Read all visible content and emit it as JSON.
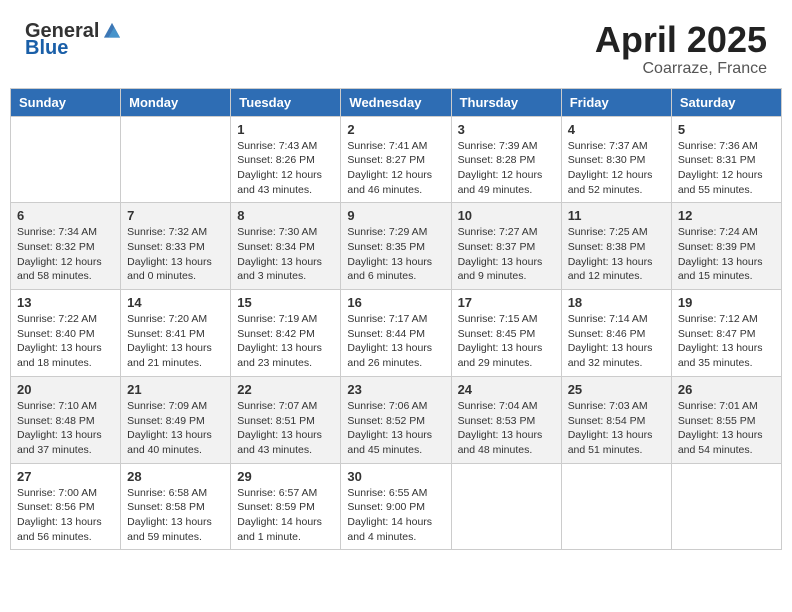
{
  "header": {
    "logo_general": "General",
    "logo_blue": "Blue",
    "title": "April 2025",
    "location": "Coarraze, France"
  },
  "days_of_week": [
    "Sunday",
    "Monday",
    "Tuesday",
    "Wednesday",
    "Thursday",
    "Friday",
    "Saturday"
  ],
  "weeks": [
    {
      "days": [
        {
          "number": "",
          "info": ""
        },
        {
          "number": "",
          "info": ""
        },
        {
          "number": "1",
          "info": "Sunrise: 7:43 AM\nSunset: 8:26 PM\nDaylight: 12 hours and 43 minutes."
        },
        {
          "number": "2",
          "info": "Sunrise: 7:41 AM\nSunset: 8:27 PM\nDaylight: 12 hours and 46 minutes."
        },
        {
          "number": "3",
          "info": "Sunrise: 7:39 AM\nSunset: 8:28 PM\nDaylight: 12 hours and 49 minutes."
        },
        {
          "number": "4",
          "info": "Sunrise: 7:37 AM\nSunset: 8:30 PM\nDaylight: 12 hours and 52 minutes."
        },
        {
          "number": "5",
          "info": "Sunrise: 7:36 AM\nSunset: 8:31 PM\nDaylight: 12 hours and 55 minutes."
        }
      ]
    },
    {
      "days": [
        {
          "number": "6",
          "info": "Sunrise: 7:34 AM\nSunset: 8:32 PM\nDaylight: 12 hours and 58 minutes."
        },
        {
          "number": "7",
          "info": "Sunrise: 7:32 AM\nSunset: 8:33 PM\nDaylight: 13 hours and 0 minutes."
        },
        {
          "number": "8",
          "info": "Sunrise: 7:30 AM\nSunset: 8:34 PM\nDaylight: 13 hours and 3 minutes."
        },
        {
          "number": "9",
          "info": "Sunrise: 7:29 AM\nSunset: 8:35 PM\nDaylight: 13 hours and 6 minutes."
        },
        {
          "number": "10",
          "info": "Sunrise: 7:27 AM\nSunset: 8:37 PM\nDaylight: 13 hours and 9 minutes."
        },
        {
          "number": "11",
          "info": "Sunrise: 7:25 AM\nSunset: 8:38 PM\nDaylight: 13 hours and 12 minutes."
        },
        {
          "number": "12",
          "info": "Sunrise: 7:24 AM\nSunset: 8:39 PM\nDaylight: 13 hours and 15 minutes."
        }
      ]
    },
    {
      "days": [
        {
          "number": "13",
          "info": "Sunrise: 7:22 AM\nSunset: 8:40 PM\nDaylight: 13 hours and 18 minutes."
        },
        {
          "number": "14",
          "info": "Sunrise: 7:20 AM\nSunset: 8:41 PM\nDaylight: 13 hours and 21 minutes."
        },
        {
          "number": "15",
          "info": "Sunrise: 7:19 AM\nSunset: 8:42 PM\nDaylight: 13 hours and 23 minutes."
        },
        {
          "number": "16",
          "info": "Sunrise: 7:17 AM\nSunset: 8:44 PM\nDaylight: 13 hours and 26 minutes."
        },
        {
          "number": "17",
          "info": "Sunrise: 7:15 AM\nSunset: 8:45 PM\nDaylight: 13 hours and 29 minutes."
        },
        {
          "number": "18",
          "info": "Sunrise: 7:14 AM\nSunset: 8:46 PM\nDaylight: 13 hours and 32 minutes."
        },
        {
          "number": "19",
          "info": "Sunrise: 7:12 AM\nSunset: 8:47 PM\nDaylight: 13 hours and 35 minutes."
        }
      ]
    },
    {
      "days": [
        {
          "number": "20",
          "info": "Sunrise: 7:10 AM\nSunset: 8:48 PM\nDaylight: 13 hours and 37 minutes."
        },
        {
          "number": "21",
          "info": "Sunrise: 7:09 AM\nSunset: 8:49 PM\nDaylight: 13 hours and 40 minutes."
        },
        {
          "number": "22",
          "info": "Sunrise: 7:07 AM\nSunset: 8:51 PM\nDaylight: 13 hours and 43 minutes."
        },
        {
          "number": "23",
          "info": "Sunrise: 7:06 AM\nSunset: 8:52 PM\nDaylight: 13 hours and 45 minutes."
        },
        {
          "number": "24",
          "info": "Sunrise: 7:04 AM\nSunset: 8:53 PM\nDaylight: 13 hours and 48 minutes."
        },
        {
          "number": "25",
          "info": "Sunrise: 7:03 AM\nSunset: 8:54 PM\nDaylight: 13 hours and 51 minutes."
        },
        {
          "number": "26",
          "info": "Sunrise: 7:01 AM\nSunset: 8:55 PM\nDaylight: 13 hours and 54 minutes."
        }
      ]
    },
    {
      "days": [
        {
          "number": "27",
          "info": "Sunrise: 7:00 AM\nSunset: 8:56 PM\nDaylight: 13 hours and 56 minutes."
        },
        {
          "number": "28",
          "info": "Sunrise: 6:58 AM\nSunset: 8:58 PM\nDaylight: 13 hours and 59 minutes."
        },
        {
          "number": "29",
          "info": "Sunrise: 6:57 AM\nSunset: 8:59 PM\nDaylight: 14 hours and 1 minute."
        },
        {
          "number": "30",
          "info": "Sunrise: 6:55 AM\nSunset: 9:00 PM\nDaylight: 14 hours and 4 minutes."
        },
        {
          "number": "",
          "info": ""
        },
        {
          "number": "",
          "info": ""
        },
        {
          "number": "",
          "info": ""
        }
      ]
    }
  ]
}
